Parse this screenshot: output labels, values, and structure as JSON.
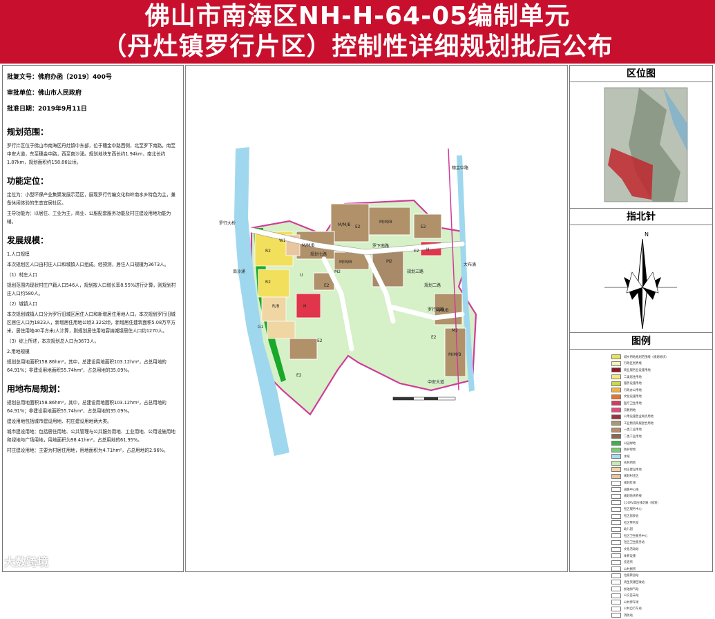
{
  "header": {
    "title_line1": "佛山市南海区NH-H-64-05编制单元",
    "title_line2": "（丹灶镇罗行片区）控制性详细规划批后公布"
  },
  "approval": {
    "doc_no": "批复文号：佛府办函〔2019〕400号",
    "unit": "审批单位：佛山市人民政府",
    "date": "批准日期：2019年9月11日"
  },
  "scope": {
    "heading": "规划范围：",
    "text": "罗行片区位于佛山市南海区丹灶镇中东部，位于穗金中路西侧，北至罗下南路，南至中安大道，东至穗金中路，西至南沙涌。规划地块东西长约1.94km，南北长约1.87km，规划面积约158.86公顷。"
  },
  "function": {
    "heading": "功能定位：",
    "p1": "定位为：小型环保产业集聚发展示范区，展现罗行竹编文化和岭南水乡特色为主，兼备休闲体验的生态宜居社区。",
    "p2": "主导功能为：以居住、工业为主，商业、公服配套服务功能及村庄建设用地功能为辅。"
  },
  "scale": {
    "heading": "发展规模：",
    "s1": "1.人口规模",
    "s1_text": "本次规划区人口由村庄人口和城镇人口组成。经预测，居住人口规模为3673人。",
    "s1_1": "（1）村庄人口",
    "s1_1_text": "规划范围内现状村庄户籍人口546人，规划按人口增长率8.55%进行计算，则规划村庄人口约580人。",
    "s1_2": "（2）城镇人口",
    "s1_2_text": "本次规划城镇人口分为罗行旧城区居住人口和新增居住用地人口。本次规划罗行旧城区居住人口为1823人，新增居住用地公顷3.32公顷，新增居住建筑面积5.08万平方米，居住用地40平方米/人计算，则规划居住用地容纳城镇居住人口约1270人。",
    "s1_3": "（3）综上所述，本次规划总人口为3673人。",
    "s2": "2.用地规模",
    "s2_text": "规划总用地面积158.86hm²，其中，总建设用地面积103.12hm²，占总用地的64.91%；非建设用地面积55.74hm²，占总用地的35.09%。"
  },
  "layout": {
    "heading": "用地布局规划：",
    "p1": "规划总用地面积158.86hm²，其中，总建设用地面积103.12hm²，占总用地的64.91%；非建设用地面积55.74hm²，占总用地的35.09%。",
    "p2": "建设用地包括城市建设用地、村庄建设用地两大类。",
    "p3": "城市建设用地：包括居住用地、公共管理与公共服务用地、工业用地、公用设施用地和绿地与广场用地，用地面积为98.41hm²，占总用地的61.95%。",
    "p4": "村庄建设用地：主要为村居住用地，用地面积为4.71hm²，占总用地的2.96%。"
  },
  "map": {
    "road_labels": [
      "罗行大桥",
      "罗下南路",
      "规划三路",
      "规划二路",
      "罗行四路",
      "规划七路",
      "南沙涌",
      "大布涌",
      "穗金中路",
      "中安大道"
    ],
    "codes": [
      "M/M/B",
      "M/M/B",
      "M/M/B",
      "M/M/B",
      "M/M/B",
      "M/M/B",
      "E2",
      "E2",
      "E2",
      "E2",
      "E2",
      "E2",
      "E2",
      "M2",
      "M2",
      "M2",
      "R2",
      "R2",
      "H",
      "H",
      "W1",
      "G1",
      "U",
      "R/B"
    ],
    "colors": {
      "water": "#9fd8ee",
      "green": "#1aa82a",
      "farmland": "#d6f0c8",
      "industrial": "#b0916a",
      "residential": "#f2e05c",
      "commercial": "#e0354a",
      "boundary": "#d13b9a"
    }
  },
  "right": {
    "loc_title": "区位图",
    "north_title": "指北针",
    "north_letter": "N",
    "legend_title": "图例"
  },
  "legend": [
    {
      "color": "#e8e25a",
      "label": "城乡用地规划范围线（规划地块）"
    },
    {
      "color": "#f6f3b8",
      "label": "行政区划界线"
    },
    {
      "color": "#8b1a2b",
      "label": "商业服务业设施用地"
    },
    {
      "color": "#f4ea7a",
      "label": "二类居住用地"
    },
    {
      "color": "#c9d94a",
      "label": "服务设施用地"
    },
    {
      "color": "#f0b24a",
      "label": "行政办公用地"
    },
    {
      "color": "#e6742a",
      "label": "文化设施用地"
    },
    {
      "color": "#d73a5a",
      "label": "医疗卫生用地"
    },
    {
      "color": "#e24a7e",
      "label": "宗教用地"
    },
    {
      "color": "#9a3442",
      "label": "公用设施营业网点用地"
    },
    {
      "color": "#a79a78",
      "label": "工业物流商服混合用地"
    },
    {
      "color": "#b58e6c",
      "label": "一类工业用地"
    },
    {
      "color": "#8d6a4e",
      "label": "二类工业用地"
    },
    {
      "color": "#3db24a",
      "label": "公园绿地"
    },
    {
      "color": "#7ec97a",
      "label": "防护绿地"
    },
    {
      "color": "#a9dcef",
      "label": "水域"
    },
    {
      "color": "#c8e9b4",
      "label": "农林用地"
    },
    {
      "color": "#f0d6a2",
      "label": "村庄建设用地"
    },
    {
      "color": "#e8c6a0",
      "label": "规划村庄区"
    },
    {
      "color": "#ffffff",
      "label": "规划红线"
    },
    {
      "color": "#ffffff",
      "label": "道路中心线"
    },
    {
      "color": "#ffffff",
      "label": "规划地块界线"
    },
    {
      "color": "#ffffff",
      "label": "110KV高压线走廊（规划）"
    },
    {
      "color": "#ffffff",
      "label": "社区服务中心"
    },
    {
      "color": "#ffffff",
      "label": "社区居委会"
    },
    {
      "color": "#ffffff",
      "label": "社区警务室"
    },
    {
      "color": "#ffffff",
      "label": "幼儿园"
    },
    {
      "color": "#ffffff",
      "label": "社区卫生服务中心"
    },
    {
      "color": "#ffffff",
      "label": "社区卫生服务站"
    },
    {
      "color": "#ffffff",
      "label": "文化活动站"
    },
    {
      "color": "#ffffff",
      "label": "体育设施"
    },
    {
      "color": "#ffffff",
      "label": "托老所"
    },
    {
      "color": "#ffffff",
      "label": "公共厕所"
    },
    {
      "color": "#ffffff",
      "label": "垃圾转运站"
    },
    {
      "color": "#ffffff",
      "label": "再生资源回收站"
    },
    {
      "color": "#ffffff",
      "label": "加油加气站"
    },
    {
      "color": "#ffffff",
      "label": "公交首末站"
    },
    {
      "color": "#ffffff",
      "label": "公共停车场"
    },
    {
      "color": "#ffffff",
      "label": "公共自行车站"
    },
    {
      "color": "#ffffff",
      "label": "消防站"
    }
  ],
  "watermark": "大数跨境"
}
